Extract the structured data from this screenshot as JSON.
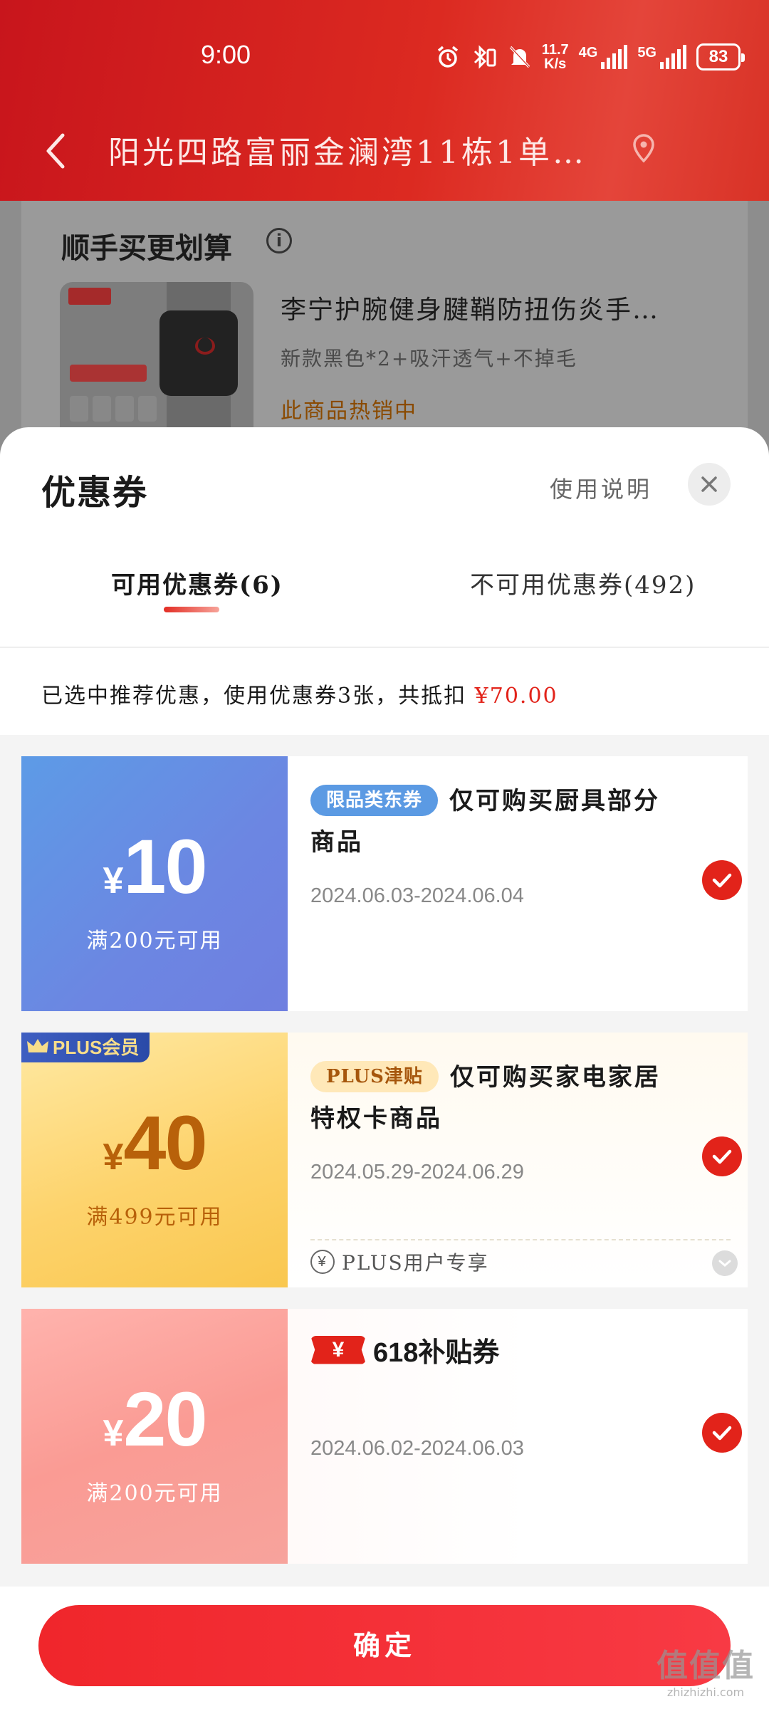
{
  "status_bar": {
    "time": "9:00",
    "net_speed_value": "11.7",
    "net_speed_unit": "K/s",
    "sim1_label": "4G",
    "sim2_label": "5G",
    "battery": "83"
  },
  "nav": {
    "address": "阳光四路富丽金澜湾11栋1单…"
  },
  "background_page": {
    "section_title": "顺手买更划算",
    "product_name": "李宁护腕健身腱鞘防扭伤炎手…",
    "product_spec": "新款黑色*2+吸汗透气+不掉毛",
    "product_status": "此商品热销中"
  },
  "sheet": {
    "title": "优惠券",
    "usage_link": "使用说明",
    "tabs": [
      {
        "label": "可用优惠券(6)",
        "active": true
      },
      {
        "label": "不可用优惠券(492)",
        "active": false
      }
    ],
    "summary_prefix": "已选中推荐优惠，使用优惠券3张，共抵扣",
    "summary_amount": "¥70.00"
  },
  "coupons": [
    {
      "currency": "¥",
      "amount": "10",
      "threshold": "满200元可用",
      "tag": "限品类东券",
      "description": "仅可购买厨具部分商品",
      "date_range": "2024.06.03-2024.06.04",
      "selected": true,
      "color": "#6c86e2"
    },
    {
      "badge": "PLUS会员",
      "currency": "¥",
      "amount": "40",
      "threshold": "满499元可用",
      "tag": "PLUS津贴",
      "description": "仅可购买家电家居特权卡商品",
      "date_range": "2024.05.29-2024.06.29",
      "footer": "PLUS用户专享",
      "selected": true,
      "color": "#fdd36c"
    },
    {
      "currency": "¥",
      "amount": "20",
      "threshold": "满200元可用",
      "subsidy_badge": "¥",
      "subsidy_title": "618补贴券",
      "date_range": "2024.06.02-2024.06.03",
      "selected": true,
      "color": "#fa9b94"
    }
  ],
  "footer": {
    "confirm_label": "确定"
  },
  "watermark": {
    "glyphs": "值值值",
    "url": "zhizhizhi.com"
  },
  "colors": {
    "brand_red": "#e2231a",
    "header_red": "#d0201c"
  }
}
